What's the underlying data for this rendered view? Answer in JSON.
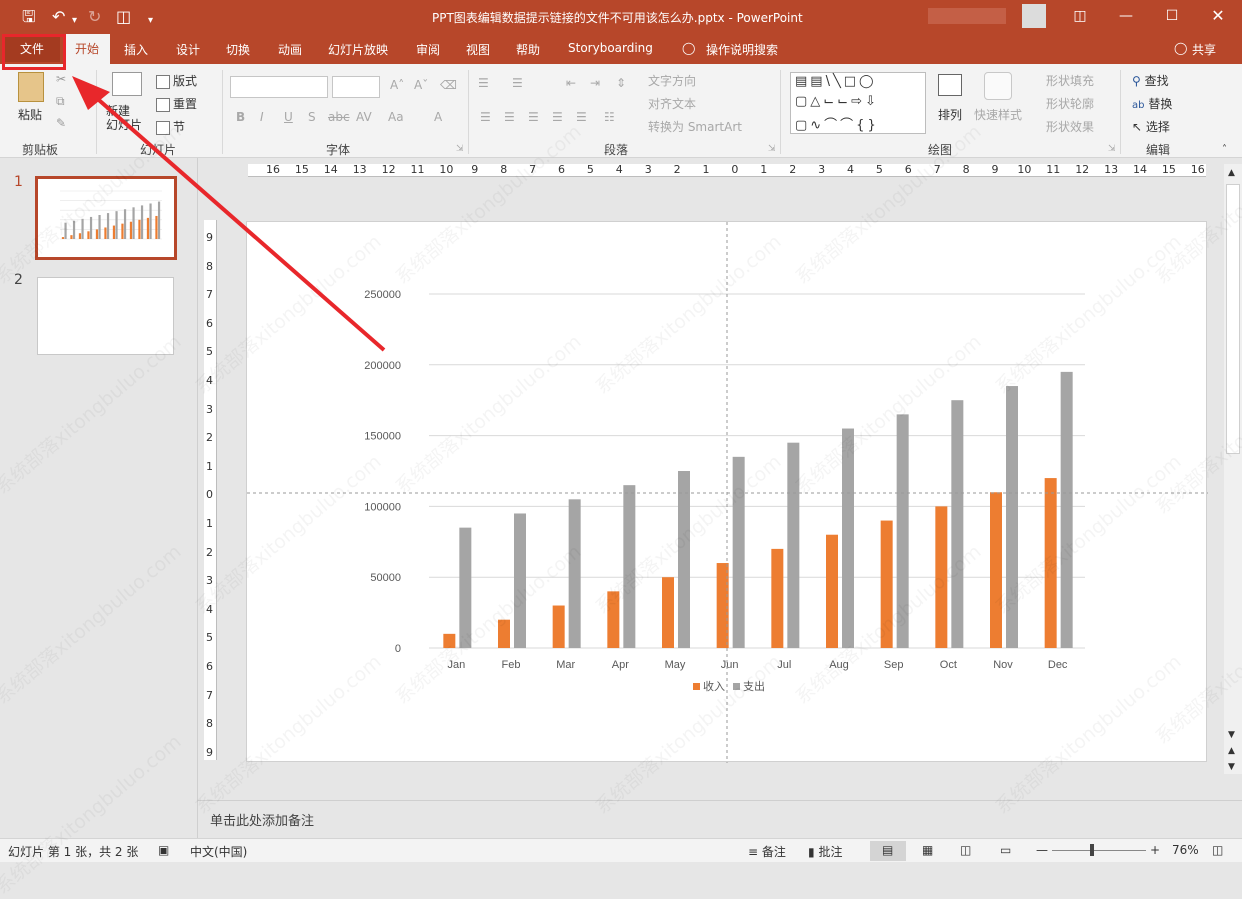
{
  "window": {
    "title": "PPT图表编辑数据提示链接的文件不可用该怎么办.pptx  -  PowerPoint",
    "share_label": "共享"
  },
  "tabs": [
    "文件",
    "开始",
    "插入",
    "设计",
    "切换",
    "动画",
    "幻灯片放映",
    "审阅",
    "视图",
    "帮助",
    "Storyboarding",
    "操作说明搜索"
  ],
  "active_tab": "开始",
  "ribbon": {
    "clipboard": {
      "paste": "粘贴",
      "label": "剪贴板"
    },
    "slides": {
      "new_slide": "新建\n幻灯片",
      "layout": "版式",
      "reset": "重置",
      "section": "节",
      "label": "幻灯片"
    },
    "font": {
      "bold": "B",
      "italic": "I",
      "underline": "U",
      "shadow": "S",
      "strike": "abc",
      "spacing": "AV",
      "case": "Aa",
      "color": "A",
      "label": "字体"
    },
    "paragraph": {
      "text_direction": "文字方向",
      "align_text": "对齐文本",
      "smartart": "转换为 SmartArt",
      "label": "段落"
    },
    "drawing": {
      "arrange": "排列",
      "quick_styles": "快速样式",
      "shape_fill": "形状填充",
      "shape_outline": "形状轮廓",
      "shape_effects": "形状效果",
      "label": "绘图"
    },
    "editing": {
      "find": "查找",
      "replace": "替换",
      "select": "选择",
      "label": "编辑"
    }
  },
  "thumbnails": [
    {
      "num": "1",
      "active": true
    },
    {
      "num": "2",
      "active": false
    }
  ],
  "ruler": {
    "h": [
      "16",
      "15",
      "14",
      "13",
      "12",
      "11",
      "10",
      "9",
      "8",
      "7",
      "6",
      "5",
      "4",
      "3",
      "2",
      "1",
      "0",
      "1",
      "2",
      "3",
      "4",
      "5",
      "6",
      "7",
      "8",
      "9",
      "10",
      "11",
      "12",
      "13",
      "14",
      "15",
      "16"
    ],
    "v": [
      "9",
      "8",
      "7",
      "6",
      "5",
      "4",
      "3",
      "2",
      "1",
      "0",
      "1",
      "2",
      "3",
      "4",
      "5",
      "6",
      "7",
      "8",
      "9"
    ]
  },
  "chart_data": {
    "type": "bar",
    "categories": [
      "Jan",
      "Feb",
      "Mar",
      "Apr",
      "May",
      "Jun",
      "Jul",
      "Aug",
      "Sep",
      "Oct",
      "Nov",
      "Dec"
    ],
    "series": [
      {
        "name": "收入",
        "color": "#ed7d31",
        "values": [
          10000,
          20000,
          30000,
          40000,
          50000,
          60000,
          70000,
          80000,
          90000,
          100000,
          110000,
          120000
        ]
      },
      {
        "name": "支出",
        "color": "#a5a5a5",
        "values": [
          85000,
          95000,
          105000,
          115000,
          125000,
          135000,
          145000,
          155000,
          165000,
          175000,
          185000,
          195000
        ]
      }
    ],
    "yticks": [
      "250000",
      "200000",
      "150000",
      "100000",
      "50000",
      "0"
    ],
    "ylim": [
      0,
      250000
    ],
    "legend": "bottom",
    "grid": true
  },
  "notes_placeholder": "单击此处添加备注",
  "status": {
    "slide_info": "幻灯片 第 1 张，共 2 张",
    "language": "中文(中国)",
    "notes": "备注",
    "comments": "批注",
    "zoom": "76%"
  },
  "watermark": "系统部落xitongbuluo.com",
  "accent_color": "#b7472a"
}
